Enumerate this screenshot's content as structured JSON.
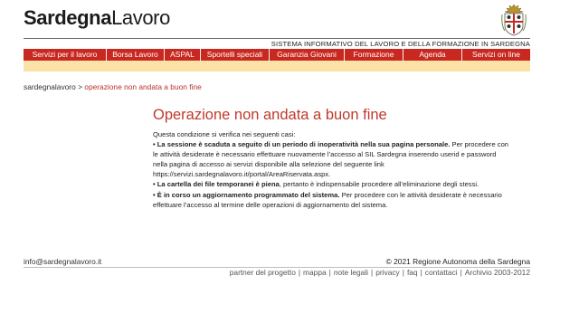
{
  "brand": {
    "bold": "Sardegna",
    "regular": "Lavoro"
  },
  "emblem_icon": "sardinia-coat-of-arms-icon",
  "system_title": "SISTEMA INFORMATIVO DEL LAVORO E DELLA FORMAZIONE IN SARDEGNA",
  "colors": {
    "nav_bg": "#c8281f",
    "subnav_bg": "#fbe3a8",
    "title": "#c0392b"
  },
  "nav": {
    "items": [
      "Servizi per il lavoro",
      "Borsa Lavoro",
      "ASPAL",
      "Sportelli speciali",
      "Garanzia Giovani",
      "Formazione",
      "Agenda",
      "Servizi on line"
    ]
  },
  "breadcrumb": {
    "home": "sardegnalavoro",
    "sep": ">",
    "current": "operazione non andata a buon fine"
  },
  "page_title": "Operazione non andata a buon fine",
  "content": {
    "intro": "Questa condizione si verifica nei seguenti casi:",
    "case1_bold": "• La sessione è scaduta a seguito di un periodo di inoperatività nella sua pagina personale.",
    "case1_text": " Per procedere con le attività desiderate è necessario effettuare nuovamente l’accesso al SIL Sardegna inserendo userid e password nella pagina di accesso ai servizi disponibile alla selezione del seguente link ",
    "case1_link": "https://servizi.sardegnalavoro.it/portal/AreaRiservata.aspx.",
    "case2_bold": "• La cartella dei file temporanei è piena",
    "case2_text": ", pertanto è indispensabile procedere all’eliminazione degli stessi.",
    "case3_bold": "• È in corso un aggiornamento programmato del sistema.",
    "case3_text": " Per procedere con le attività desiderate è necessario effettuare l’accesso al termine delle operazioni di aggiornamento del sistema."
  },
  "footer": {
    "email": "info@sardegnalavoro.it",
    "copyright": "© 2021 Regione Autonoma della Sardegna",
    "links": [
      "partner del progetto",
      "mappa",
      "note legali",
      "privacy",
      "faq",
      "contattaci",
      "Archivio 2003-2012"
    ],
    "separator": "|"
  }
}
